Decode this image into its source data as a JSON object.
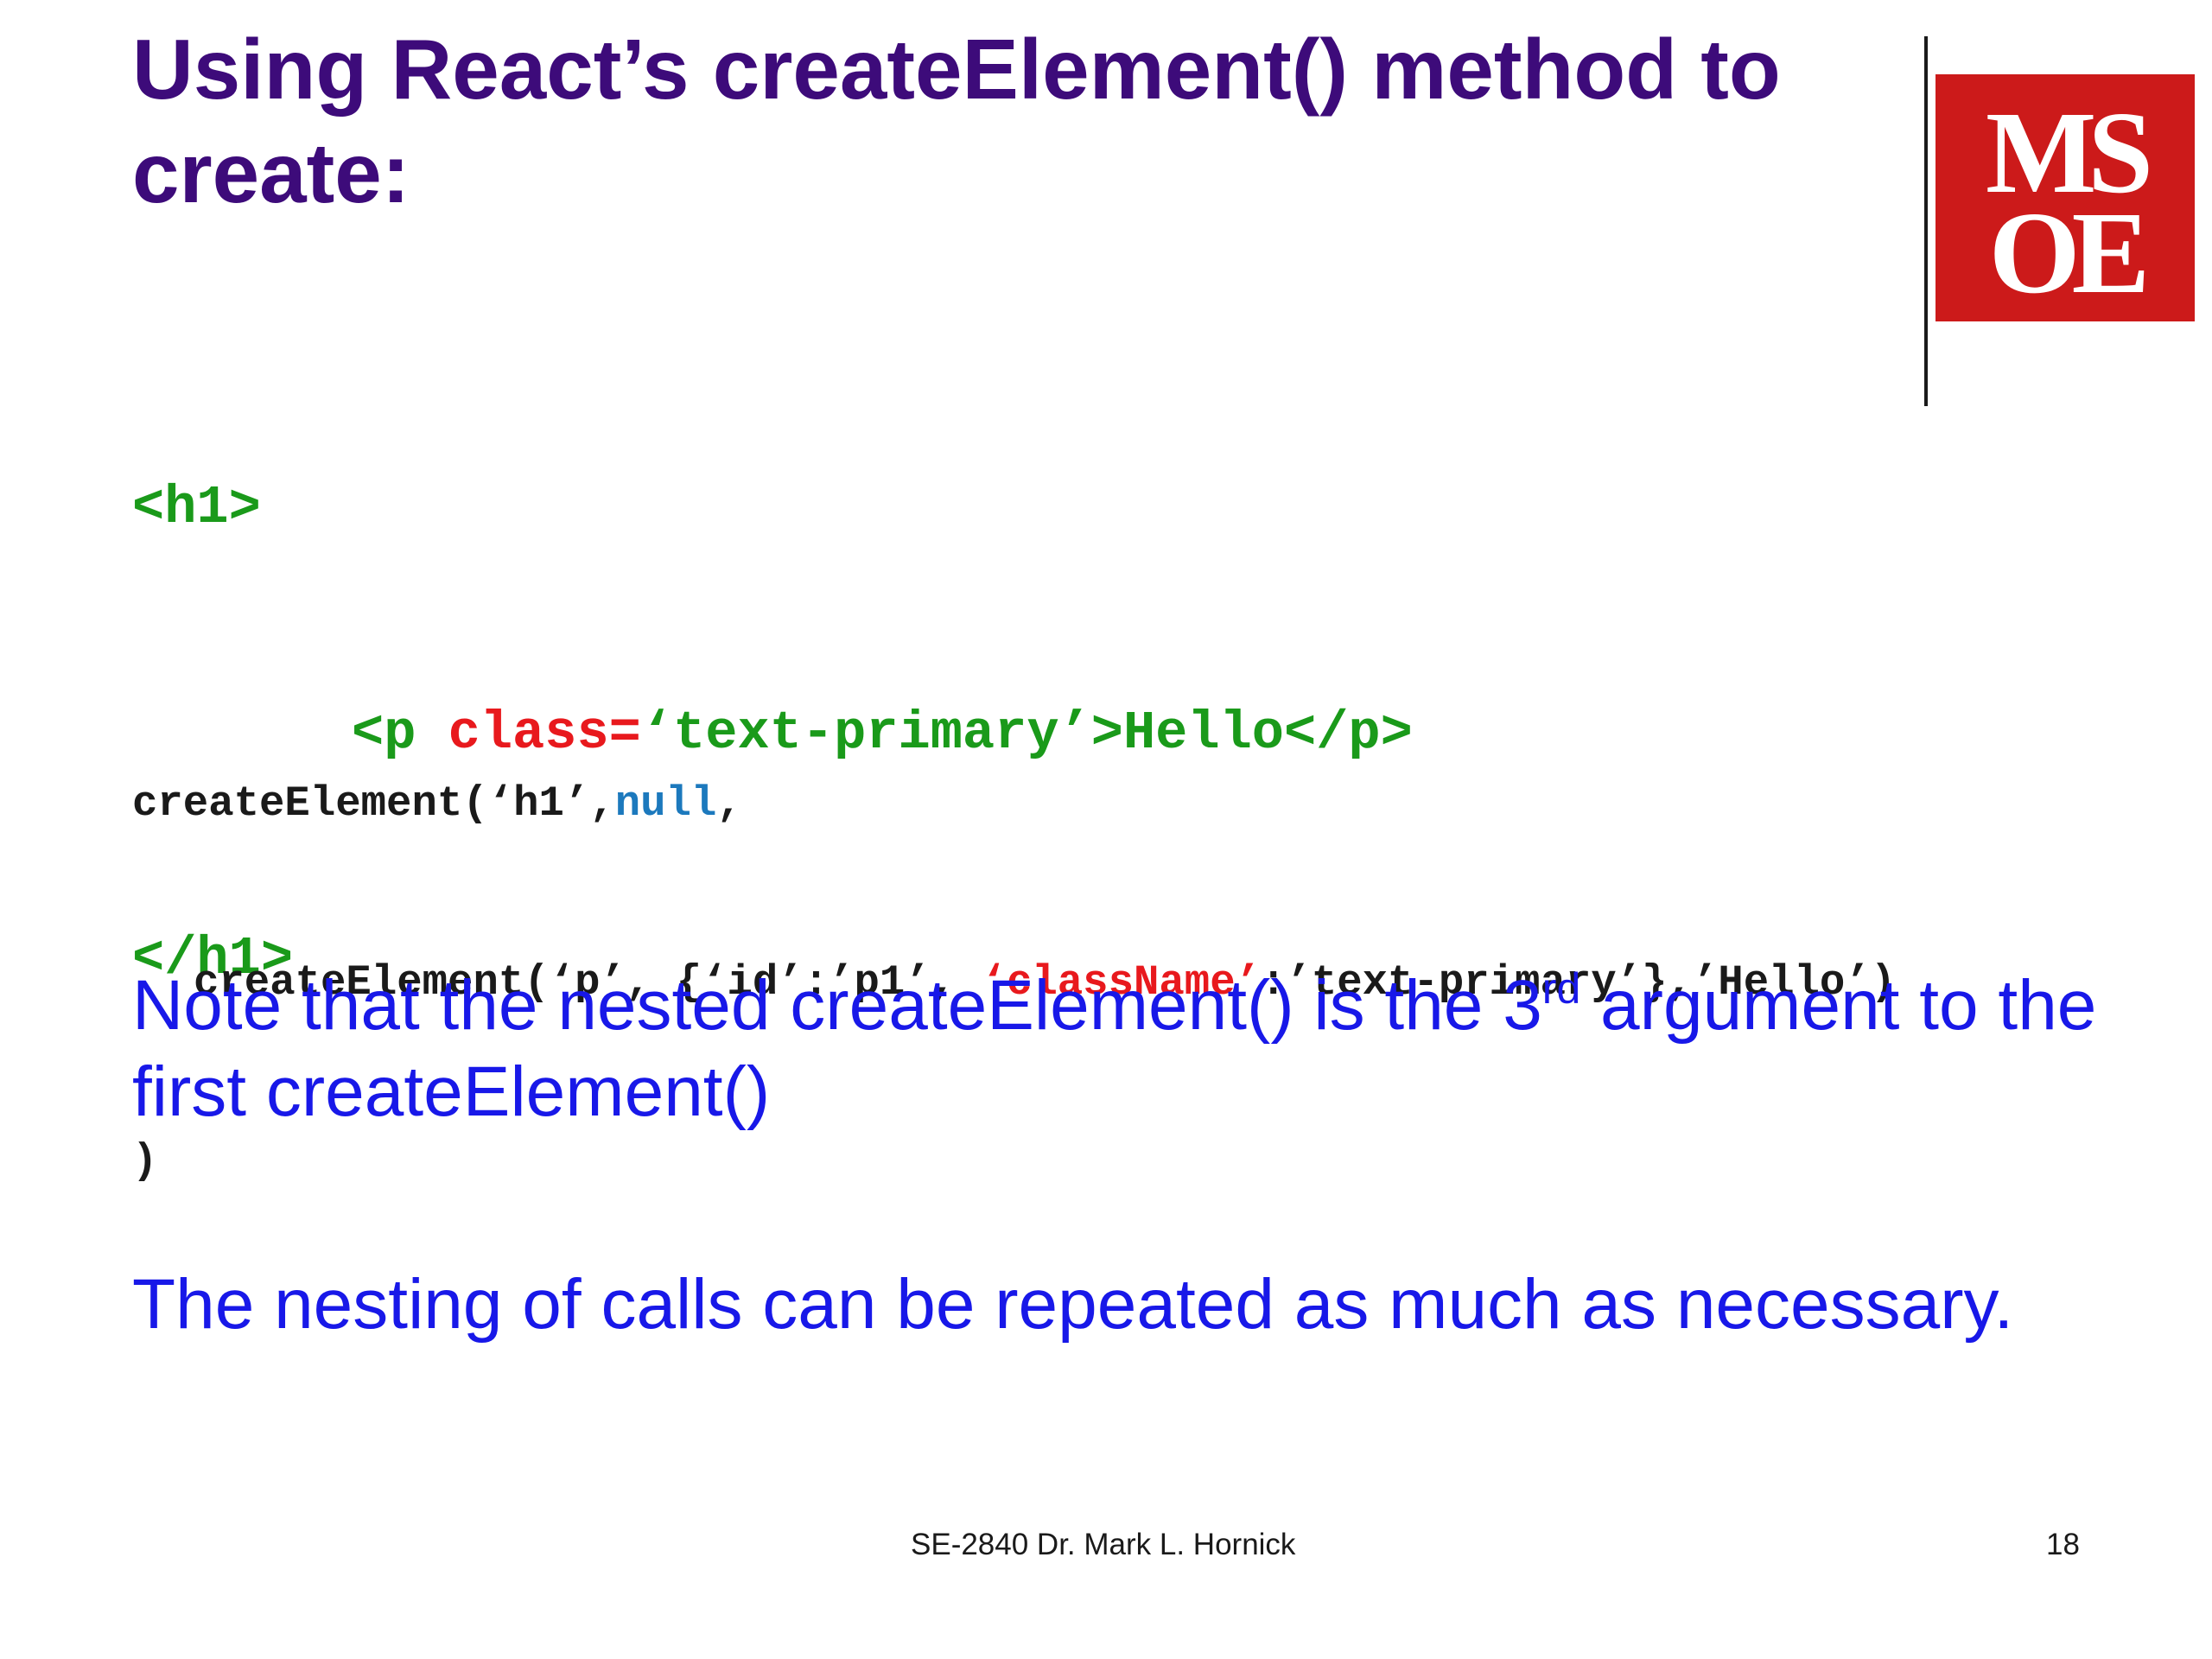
{
  "slide": {
    "title_line1": "Using React’s createElement() method to",
    "title_line2": "create:",
    "logo": {
      "letters_top": "MS",
      "letters_bottom": "OE",
      "background_color": "#cc1a1a",
      "text_color": "#ffffff"
    },
    "html_code": {
      "line1": "<h1>",
      "line2_tag_open": "<p ",
      "line2_attr": "class=",
      "line2_value": "‘text-primary’>Hello</p>",
      "line3": "</h1>"
    },
    "js_code": {
      "line1_start": "createElement(‘h1’,",
      "line1_null": "null",
      "line1_end": ",",
      "line2_start": "createElement(‘p’, {‘id’:’p1’, ",
      "line2_classname": "‘className’",
      "line2_end": ":’text-primary’},’Hello’)",
      "line3": ")"
    },
    "note1_before_sup": "Note that the nested createElement() is the 3",
    "note1_sup": "rd",
    "note1_after_sup": " argument to the first createElement()",
    "note2": "The nesting of calls can be repeated as much as necessary.",
    "footer_credit": "SE-2840 Dr. Mark L. Hornick",
    "page_number": "18"
  },
  "colors": {
    "title": "#3d0b7a",
    "html_code": "#1a9a1a",
    "html_attr": "#e8191d",
    "js_code": "#1a1a1a",
    "js_null": "#1c79bd",
    "js_classname": "#e8191d",
    "note_text": "#1818e8"
  }
}
